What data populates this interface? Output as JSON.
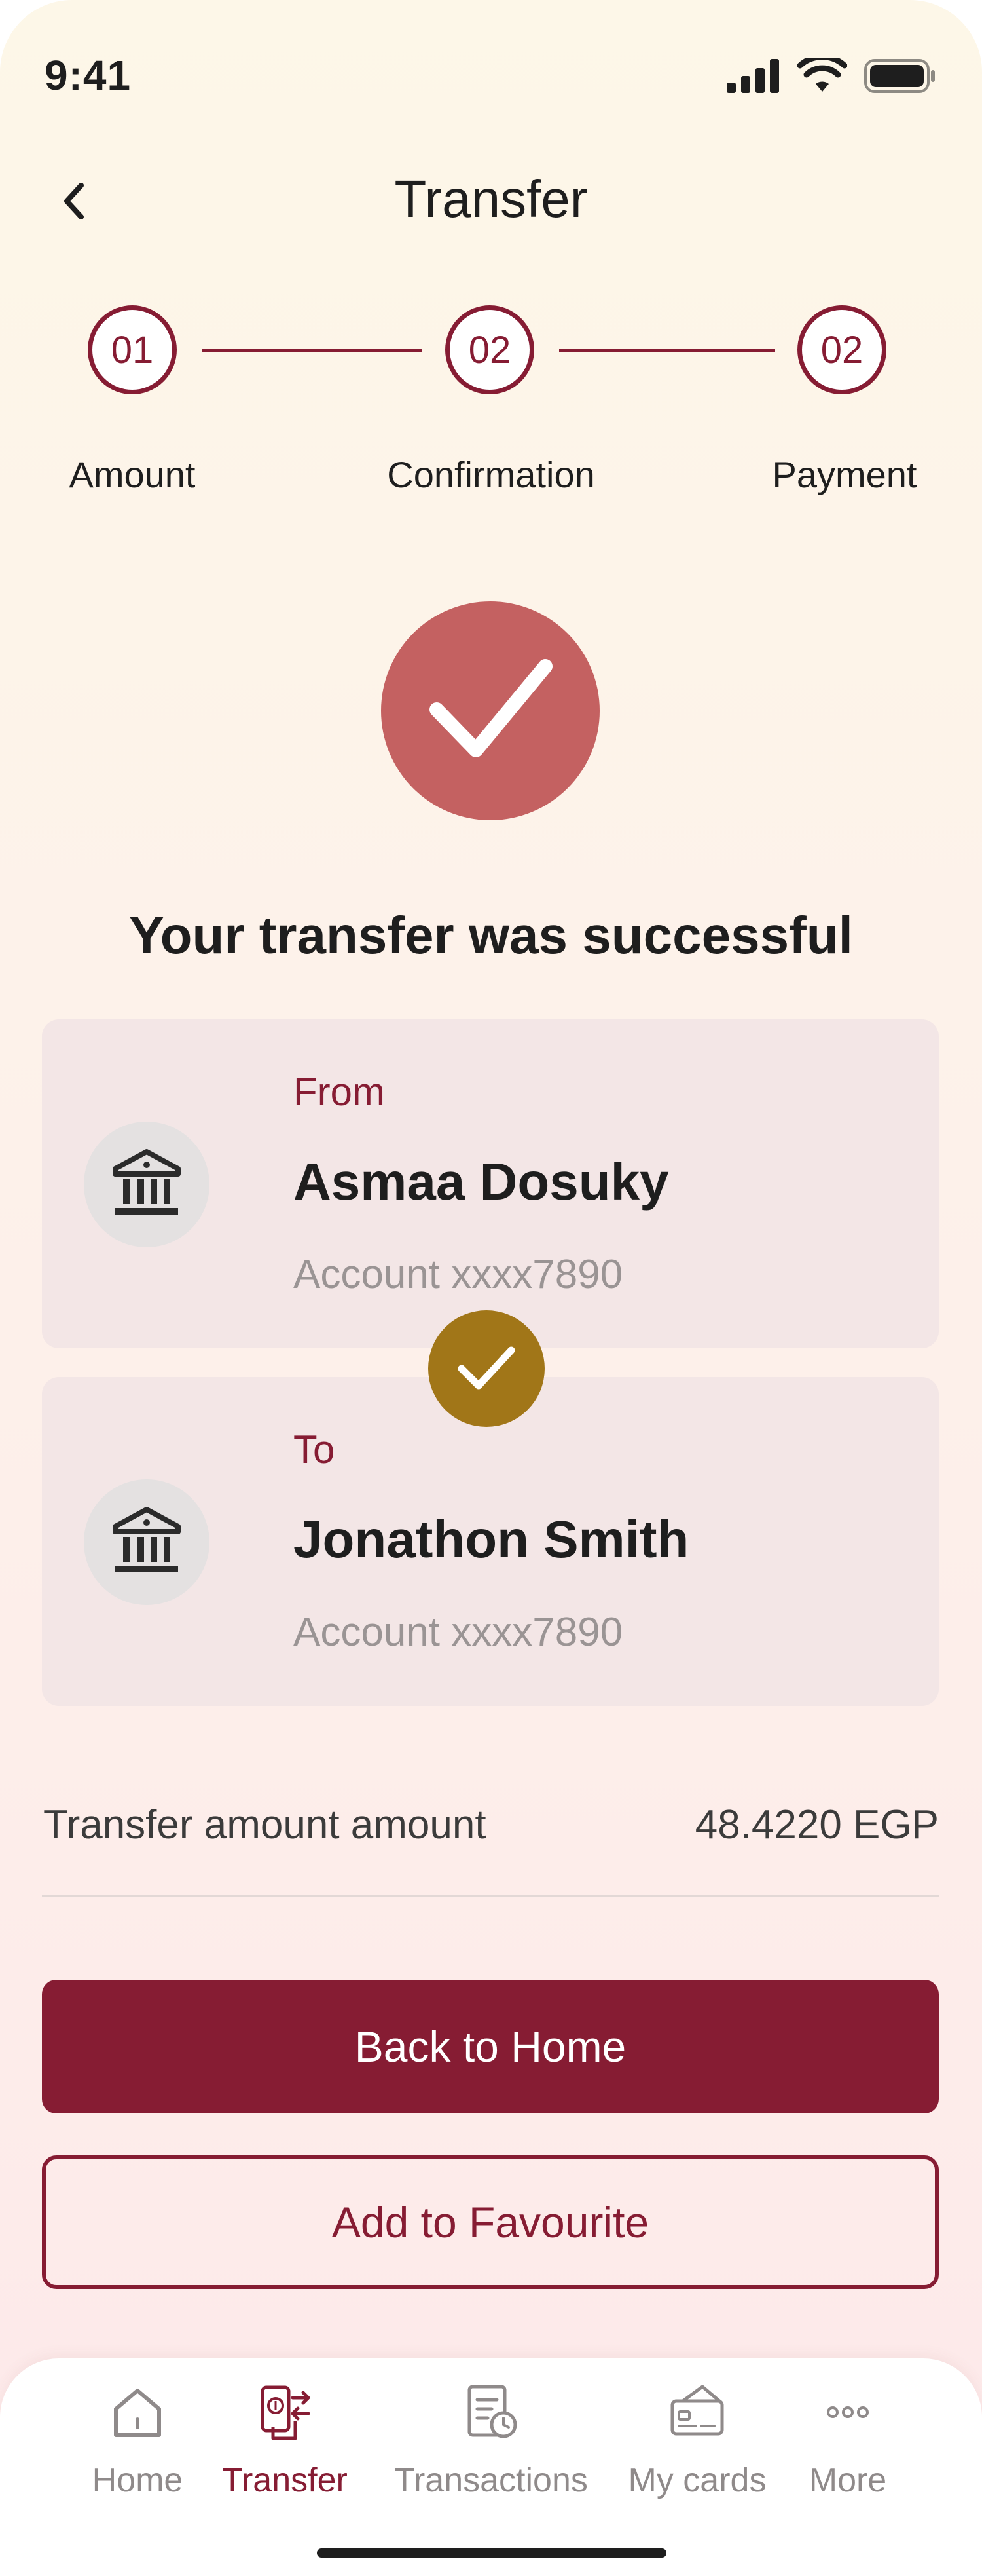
{
  "status_bar": {
    "time": "9:41"
  },
  "header": {
    "title": "Transfer"
  },
  "stepper": {
    "steps": [
      {
        "number": "01",
        "label": "Amount"
      },
      {
        "number": "02",
        "label": "Confirmation"
      },
      {
        "number": "02",
        "label": "Payment"
      }
    ]
  },
  "success": {
    "message": "Your transfer was successful"
  },
  "from_account": {
    "label": "From",
    "name": "Asmaa Dosuky",
    "account": "Account xxxx7890"
  },
  "to_account": {
    "label": "To",
    "name": "Jonathon Smith",
    "account": "Account xxxx7890"
  },
  "amount": {
    "label": "Transfer amount amount",
    "value": "48.4220 EGP"
  },
  "actions": {
    "primary_label": "Back to Home",
    "secondary_label": "Add to Favourite"
  },
  "bottom_nav": {
    "items": [
      {
        "label": "Home",
        "icon": "home-icon"
      },
      {
        "label": "Transfer",
        "icon": "transfer-icon",
        "active": true
      },
      {
        "label": "Transactions",
        "icon": "transactions-icon"
      },
      {
        "label": "My cards",
        "icon": "card-icon"
      },
      {
        "label": "More",
        "icon": "more-icon"
      }
    ]
  },
  "colors": {
    "brand": "#861c33",
    "success_circle": "#c46161",
    "swap_badge": "#a17618",
    "card_bg": "#f3e6e6"
  }
}
